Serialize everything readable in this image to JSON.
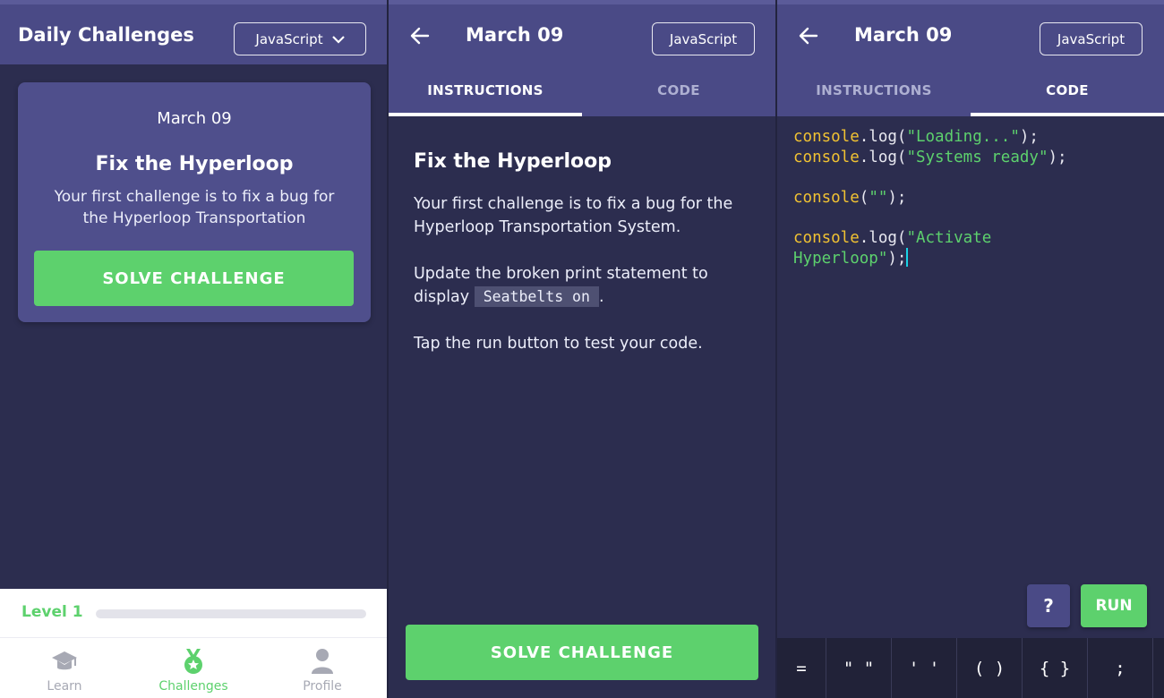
{
  "colors": {
    "header": "#4a4a86",
    "background": "#2c2d4f",
    "accent_green": "#5dd16d",
    "code_object": "#f1c232",
    "code_string": "#5dd16d",
    "cursor": "#19d2e6"
  },
  "home": {
    "title": "Daily Challenges",
    "language": "JavaScript",
    "card": {
      "date": "March 09",
      "title": "Fix the Hyperloop",
      "description": "Your first challenge is to fix a bug for the Hyperloop Transportation",
      "button": "SOLVE CHALLENGE"
    },
    "level": {
      "label": "Level 1",
      "progress": 0
    },
    "nav": [
      {
        "label": "Learn",
        "icon": "graduation-cap-icon"
      },
      {
        "label": "Challenges",
        "icon": "medal-icon",
        "active": true
      },
      {
        "label": "Profile",
        "icon": "person-icon"
      }
    ]
  },
  "detail": {
    "title": "March 09",
    "language": "JavaScript",
    "tabs": {
      "instructions": "INSTRUCTIONS",
      "code": "CODE"
    },
    "instructions": {
      "title": "Fix the Hyperloop",
      "p1": "Your first challenge is to fix a bug for the Hyperloop Transportation System.",
      "p2_before": "Update the broken print statement to display",
      "p2_code": "Seatbelts on",
      "p2_after": ".",
      "p3": "Tap the run button to test your code."
    },
    "button": "SOLVE CHALLENGE"
  },
  "editor": {
    "title": "March 09",
    "language": "JavaScript",
    "tabs": {
      "instructions": "INSTRUCTIONS",
      "code": "CODE"
    },
    "code": {
      "l1_obj": "console",
      "l1_fn": ".log(",
      "l1_str": "\"Loading...\"",
      "l1_end": ");",
      "l2_obj": "console",
      "l2_fn": ".log(",
      "l2_str": "\"Systems ready\"",
      "l2_end": ");",
      "l3_obj": "console",
      "l3_fn": "(",
      "l3_str": "\"\"",
      "l3_end": ");",
      "l4_obj": "console",
      "l4_fn": ".log(",
      "l4_str_a": "\"Activate",
      "l4_str_b": "Hyperloop\"",
      "l4_end": ");"
    },
    "help_label": "?",
    "run_label": "RUN",
    "keys": [
      "=",
      "\" \"",
      "' '",
      "( )",
      "{ }",
      ";",
      "+"
    ]
  }
}
